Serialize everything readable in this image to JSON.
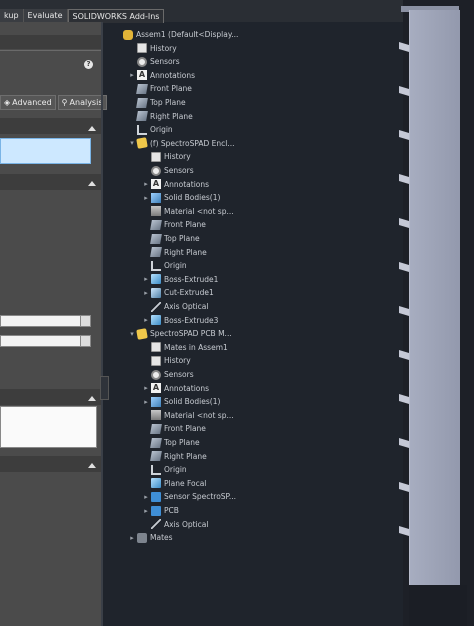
{
  "tabs": [
    "kup",
    "Evaluate",
    "SOLIDWORKS Add-Ins"
  ],
  "left_panel": {
    "help_glyph": "?",
    "buttons": [
      "Advanced",
      "Analysis"
    ]
  },
  "tree": [
    {
      "level": 0,
      "icon": "assembly",
      "expand": "",
      "label": "Assem1  (Default<Display..."
    },
    {
      "level": 1,
      "icon": "history",
      "expand": "",
      "label": "History"
    },
    {
      "level": 1,
      "icon": "sensor",
      "expand": "",
      "label": "Sensors"
    },
    {
      "level": 1,
      "icon": "annot",
      "expand": "▸",
      "label": "Annotations"
    },
    {
      "level": 1,
      "icon": "plane",
      "expand": "",
      "label": "Front Plane"
    },
    {
      "level": 1,
      "icon": "plane",
      "expand": "",
      "label": "Top Plane"
    },
    {
      "level": 1,
      "icon": "plane",
      "expand": "",
      "label": "Right Plane"
    },
    {
      "level": 1,
      "icon": "origin",
      "expand": "",
      "label": "Origin"
    },
    {
      "level": 1,
      "icon": "part",
      "expand": "▾",
      "label": "(f) SpectroSPAD Encl..."
    },
    {
      "level": 2,
      "icon": "history",
      "expand": "",
      "label": "History"
    },
    {
      "level": 2,
      "icon": "sensor",
      "expand": "",
      "label": "Sensors"
    },
    {
      "level": 2,
      "icon": "annot",
      "expand": "▸",
      "label": "Annotations"
    },
    {
      "level": 2,
      "icon": "solid",
      "expand": "▸",
      "label": "Solid Bodies(1)"
    },
    {
      "level": 2,
      "icon": "material",
      "expand": "",
      "label": "Material <not sp..."
    },
    {
      "level": 2,
      "icon": "plane",
      "expand": "",
      "label": "Front Plane"
    },
    {
      "level": 2,
      "icon": "plane",
      "expand": "",
      "label": "Top Plane"
    },
    {
      "level": 2,
      "icon": "plane",
      "expand": "",
      "label": "Right Plane"
    },
    {
      "level": 2,
      "icon": "origin",
      "expand": "",
      "label": "Origin"
    },
    {
      "level": 2,
      "icon": "extrude",
      "expand": "▸",
      "label": "Boss-Extrude1"
    },
    {
      "level": 2,
      "icon": "cut",
      "expand": "▸",
      "label": "Cut-Extrude1"
    },
    {
      "level": 2,
      "icon": "axis",
      "expand": "",
      "label": "Axis Optical"
    },
    {
      "level": 2,
      "icon": "extrude",
      "expand": "▸",
      "label": "Boss-Extrude3"
    },
    {
      "level": 1,
      "icon": "part",
      "expand": "▾",
      "label": "SpectroSPAD PCB M..."
    },
    {
      "level": 2,
      "icon": "history",
      "expand": "",
      "label": "Mates in Assem1"
    },
    {
      "level": 2,
      "icon": "history",
      "expand": "",
      "label": "History"
    },
    {
      "level": 2,
      "icon": "sensor",
      "expand": "",
      "label": "Sensors"
    },
    {
      "level": 2,
      "icon": "annot",
      "expand": "▸",
      "label": "Annotations"
    },
    {
      "level": 2,
      "icon": "solid",
      "expand": "▸",
      "label": "Solid Bodies(1)"
    },
    {
      "level": 2,
      "icon": "material",
      "expand": "",
      "label": "Material <not sp..."
    },
    {
      "level": 2,
      "icon": "plane",
      "expand": "",
      "label": "Front Plane"
    },
    {
      "level": 2,
      "icon": "plane",
      "expand": "",
      "label": "Top Plane"
    },
    {
      "level": 2,
      "icon": "plane",
      "expand": "",
      "label": "Right Plane"
    },
    {
      "level": 2,
      "icon": "origin",
      "expand": "",
      "label": "Origin"
    },
    {
      "level": 2,
      "icon": "extrude",
      "expand": "",
      "label": "Plane Focal"
    },
    {
      "level": 2,
      "icon": "subasm",
      "expand": "▸",
      "label": "Sensor SpectroSP..."
    },
    {
      "level": 2,
      "icon": "subasm",
      "expand": "▸",
      "label": "PCB"
    },
    {
      "level": 2,
      "icon": "axis",
      "expand": "",
      "label": "Axis Optical"
    },
    {
      "level": 1,
      "icon": "mates",
      "expand": "▸",
      "label": "Mates"
    }
  ]
}
